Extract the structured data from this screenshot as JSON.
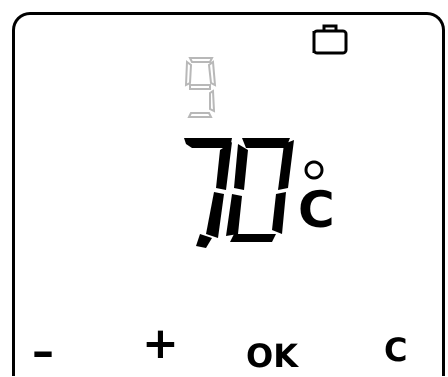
{
  "display": {
    "status_icon": "suitcase-icon",
    "program_digit": "9",
    "temperature": "7,0",
    "temperature_unit": "°C",
    "unit_letter": "C"
  },
  "softkeys": {
    "minus": "–",
    "plus": "+",
    "ok": "OK",
    "clear": "C"
  },
  "colors": {
    "segments_on": "#000000",
    "segments_dim": "#c8c8c8",
    "background": "#ffffff"
  }
}
